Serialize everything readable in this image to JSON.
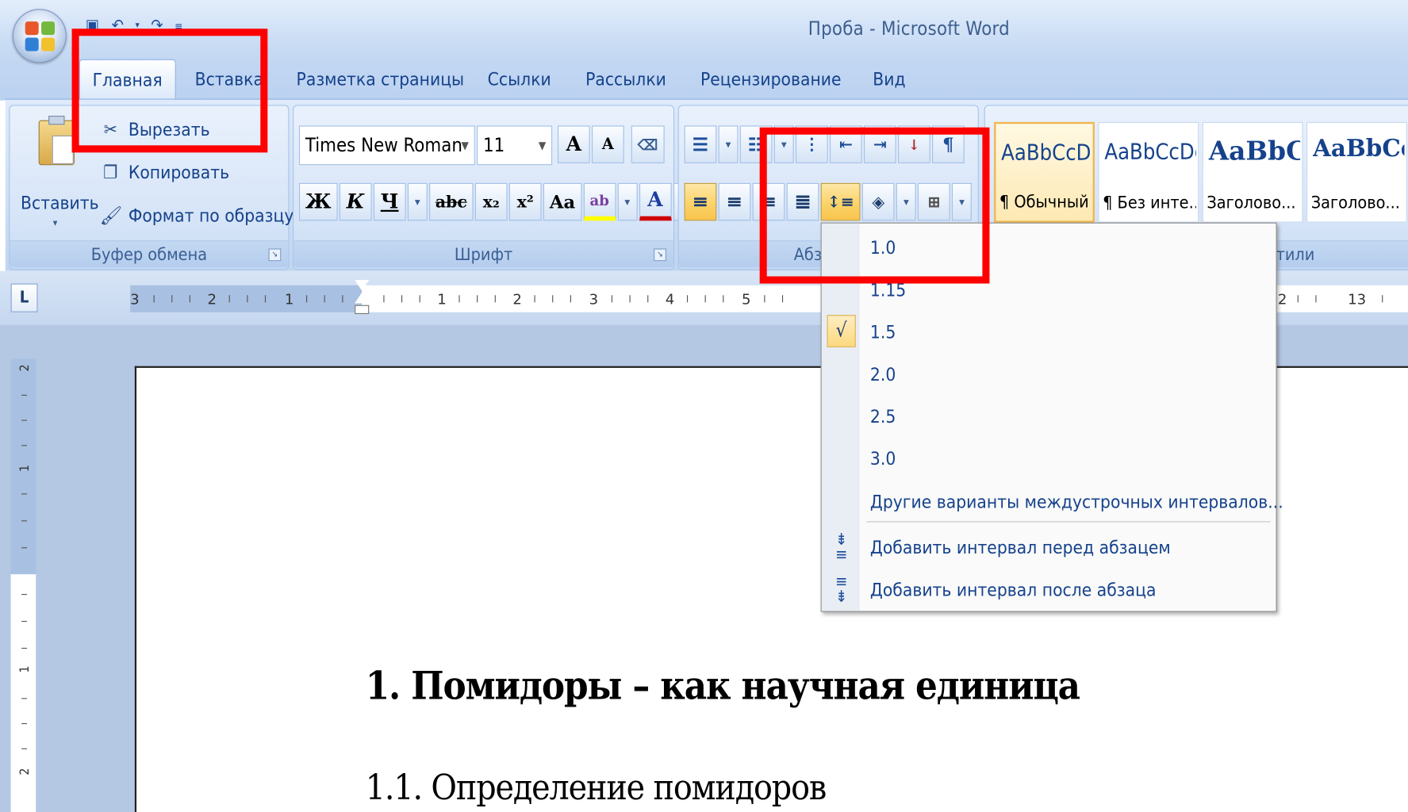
{
  "window": {
    "title": "Проба - Microsoft Word"
  },
  "tabs": [
    {
      "label": "Главная",
      "active": true
    },
    {
      "label": "Вставка",
      "active": false
    },
    {
      "label": "Разметка страницы",
      "active": false
    },
    {
      "label": "Ссылки",
      "active": false
    },
    {
      "label": "Рассылки",
      "active": false
    },
    {
      "label": "Рецензирование",
      "active": false
    },
    {
      "label": "Вид",
      "active": false
    }
  ],
  "clipboard": {
    "paste_label": "Вставить",
    "cut_label": "Вырезать",
    "copy_label": "Копировать",
    "format_painter_label": "Формат по образцу",
    "group_label": "Буфер обмена"
  },
  "font": {
    "name": "Times New Roman",
    "size": "11",
    "grow_glyph": "A",
    "shrink_glyph": "A",
    "bold": "Ж",
    "italic": "К",
    "underline": "Ч",
    "strike": "abc",
    "subscript": "x₂",
    "superscript": "x²",
    "change_case": "Aa",
    "highlight": "ab",
    "color": "A",
    "group_label": "Шрифт"
  },
  "paragraph": {
    "group_label": "Абз"
  },
  "styles": {
    "group_label": "тили",
    "items": [
      {
        "sample": "AaBbCcDc",
        "name": "¶ Обычный",
        "selected": true
      },
      {
        "sample": "AaBbCcDc",
        "name": "¶ Без инте...",
        "selected": false
      },
      {
        "sample": "AaBbC",
        "name": "Заголово...",
        "selected": false
      },
      {
        "sample": "AaBbCc",
        "name": "Заголово...",
        "selected": false
      }
    ]
  },
  "ruler": {
    "tab_selector": "L",
    "left_numbers": [
      "3",
      "2",
      "1"
    ],
    "right_numbers": [
      "1",
      "2",
      "3",
      "4",
      "5"
    ],
    "far_numbers": [
      "2",
      "13"
    ],
    "vertical_numbers": [
      "2",
      "1",
      "1",
      "2"
    ]
  },
  "line_spacing_menu": {
    "items": [
      {
        "label": "1.0",
        "checked": false
      },
      {
        "label": "1.15",
        "checked": false
      },
      {
        "label": "1.5",
        "checked": true
      },
      {
        "label": "2.0",
        "checked": false
      },
      {
        "label": "2.5",
        "checked": false
      },
      {
        "label": "3.0",
        "checked": false
      }
    ],
    "more_options": "Другие варианты междустрочных интервалов...",
    "add_before": "Добавить интервал перед абзацем",
    "add_after": "Добавить интервал после абзаца",
    "check_glyph": "√"
  },
  "document": {
    "heading1": "1. Помидоры – как научная единица",
    "heading2": "1.1. Определение помидоров"
  },
  "annotation_color": "#ff0000"
}
